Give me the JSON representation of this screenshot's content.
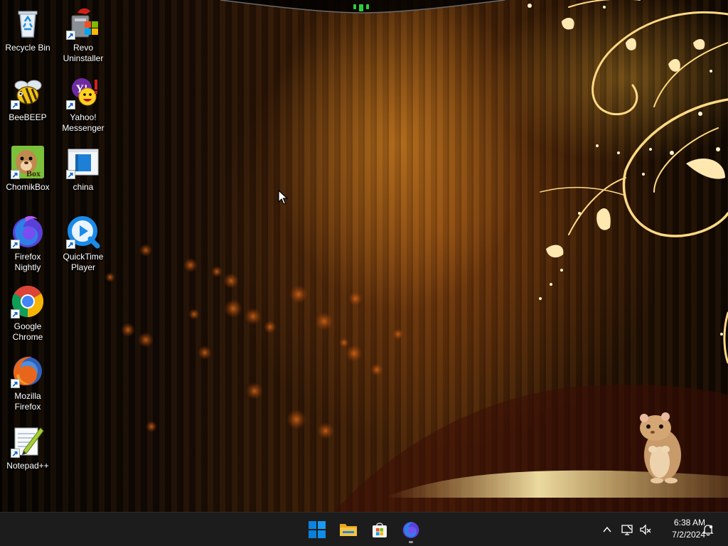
{
  "desktop": {
    "icons": [
      {
        "id": "recycle-bin",
        "label": "Recycle Bin"
      },
      {
        "id": "revo-uninstaller",
        "label": "Revo\nUninstaller"
      },
      {
        "id": "beebeep",
        "label": "BeeBEEP"
      },
      {
        "id": "yahoo-messenger",
        "label": "Yahoo!\nMessenger"
      },
      {
        "id": "chomikbox",
        "label": "ChomikBox"
      },
      {
        "id": "china",
        "label": "china"
      },
      {
        "id": "firefox-nightly",
        "label": "Firefox\nNightly"
      },
      {
        "id": "quicktime-player",
        "label": "QuickTime\nPlayer"
      },
      {
        "id": "google-chrome",
        "label": "Google\nChrome"
      },
      {
        "id": "mozilla-firefox",
        "label": "Mozilla\nFirefox"
      },
      {
        "id": "notepad-plus-plus",
        "label": "Notepad++"
      }
    ],
    "chomikbox_icon_text": "Box",
    "yahoo_icon_text": "Y!"
  },
  "taskbar": {
    "pinned": [
      {
        "id": "start",
        "icon": "windows-start-icon"
      },
      {
        "id": "file-explorer",
        "icon": "folder-icon"
      },
      {
        "id": "microsoft-store",
        "icon": "store-icon"
      },
      {
        "id": "firefox-nightly",
        "icon": "firefox-nightly-icon",
        "running": true
      }
    ],
    "tray": {
      "icons": [
        "chevron-up-icon",
        "network-icon",
        "volume-muted-icon",
        "notification-icon"
      ]
    },
    "clock": {
      "time": "6:38 AM",
      "date": "7/2/2024"
    }
  },
  "colors": {
    "taskbar_bg": "#1c1c1c",
    "windows_blue": "#0a7fd8",
    "folder_yellow": "#f6c342",
    "chrome_red": "#db4437",
    "chrome_green": "#0f9d58",
    "chrome_yellow": "#f4b400",
    "chrome_blue": "#4285f4"
  }
}
